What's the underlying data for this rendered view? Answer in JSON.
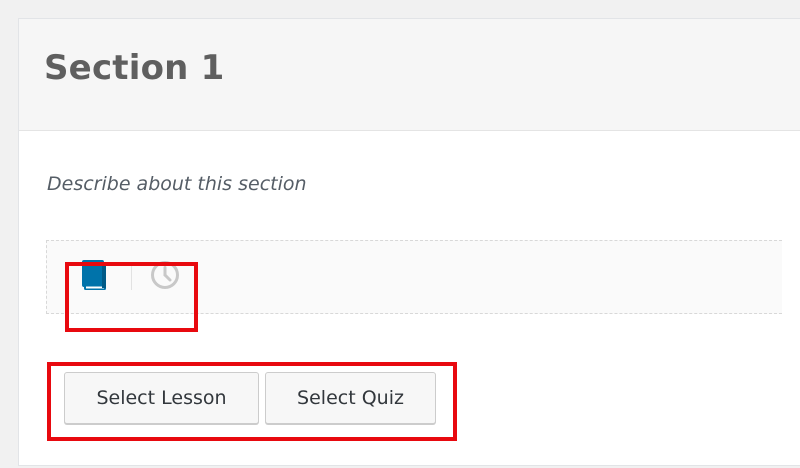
{
  "section": {
    "title": "Section 1",
    "description_placeholder": "Describe about this section"
  },
  "item_types": [
    {
      "name": "lesson",
      "icon": "book-icon",
      "color": "#0073aa",
      "active": true
    },
    {
      "name": "quiz",
      "icon": "clock-icon",
      "color": "#c8c8c8",
      "active": false
    }
  ],
  "actions": {
    "select_lesson_label": "Select Lesson",
    "select_quiz_label": "Select Quiz"
  },
  "colors": {
    "highlight": "#e8090f",
    "accent": "#0073aa"
  }
}
